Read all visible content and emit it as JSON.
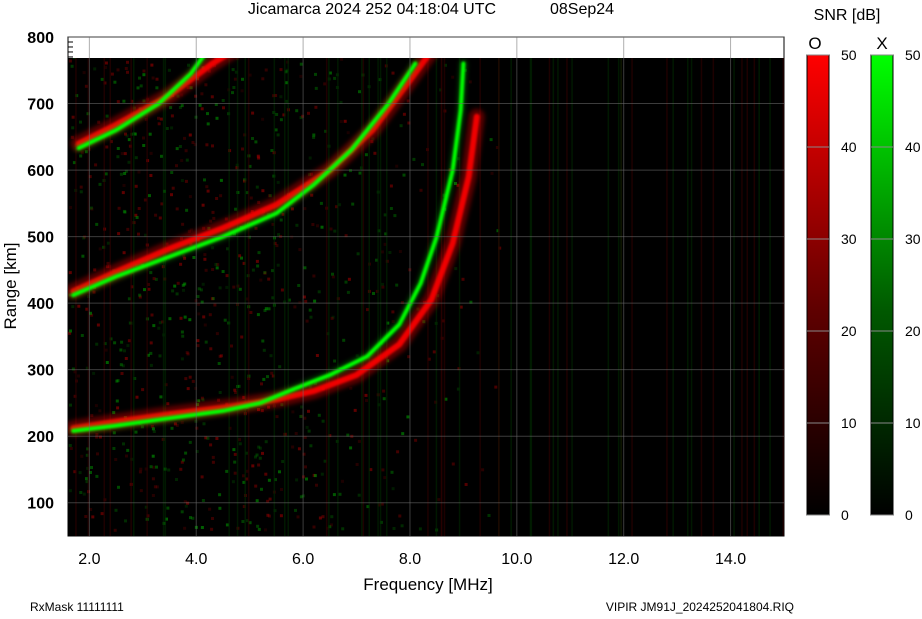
{
  "header": {
    "title": "Jicamarca 2024 252 04:18:04 UTC",
    "date": "08Sep24"
  },
  "footer": {
    "rxmask": "RxMask 11111111",
    "filename": "VIPIR  JM91J_2024252041804.RIQ"
  },
  "colorbars": {
    "title": "SNR [dB]",
    "o_label": "O",
    "x_label": "X",
    "ticks": [
      "50",
      "40",
      "30",
      "20",
      "10",
      "0"
    ],
    "o_color": "#ff0000",
    "x_color": "#00ff00",
    "range": [
      0,
      50
    ]
  },
  "chart_data": {
    "type": "heatmap",
    "title": "Jicamarca 2024 252 04:18:04 UTC",
    "xlabel": "Frequency [MHz]",
    "ylabel": "Range [km]",
    "xlim": [
      1.6,
      15.0
    ],
    "ylim": [
      50,
      800
    ],
    "x_ticks": [
      "2.0",
      "4.0",
      "6.0",
      "8.0",
      "10.0",
      "12.0",
      "14.0"
    ],
    "y_ticks": [
      "100",
      "200",
      "300",
      "400",
      "500",
      "600",
      "700",
      "800"
    ],
    "background": "#000000",
    "grid": true,
    "series": [
      {
        "name": "O",
        "color": "#ff0000",
        "traces": [
          {
            "points": [
              [
                1.7,
                212
              ],
              [
                2.5,
                222
              ],
              [
                3.5,
                233
              ],
              [
                4.5,
                243
              ],
              [
                5.5,
                255
              ],
              [
                6.2,
                268
              ],
              [
                7.0,
                292
              ],
              [
                7.8,
                338
              ],
              [
                8.4,
                405
              ],
              [
                8.8,
                490
              ],
              [
                9.1,
                590
              ],
              [
                9.25,
                680
              ]
            ]
          },
          {
            "points": [
              [
                1.7,
                418
              ],
              [
                2.5,
                447
              ],
              [
                3.5,
                482
              ],
              [
                4.5,
                513
              ],
              [
                5.5,
                548
              ],
              [
                6.5,
                600
              ],
              [
                7.3,
                660
              ],
              [
                8.0,
                735
              ],
              [
                8.5,
                790
              ]
            ]
          },
          {
            "points": [
              [
                1.8,
                640
              ],
              [
                2.5,
                668
              ],
              [
                3.5,
                712
              ],
              [
                4.3,
                760
              ],
              [
                4.9,
                790
              ]
            ]
          }
        ]
      },
      {
        "name": "X",
        "color": "#00ff00",
        "traces": [
          {
            "points": [
              [
                1.7,
                208
              ],
              [
                2.5,
                216
              ],
              [
                3.5,
                227
              ],
              [
                4.5,
                238
              ],
              [
                5.2,
                250
              ],
              [
                5.8,
                270
              ],
              [
                6.5,
                292
              ],
              [
                7.2,
                320
              ],
              [
                7.8,
                368
              ],
              [
                8.2,
                430
              ],
              [
                8.5,
                500
              ],
              [
                8.8,
                600
              ],
              [
                8.95,
                690
              ],
              [
                9.0,
                760
              ]
            ]
          },
          {
            "points": [
              [
                1.7,
                412
              ],
              [
                2.5,
                440
              ],
              [
                3.5,
                470
              ],
              [
                4.5,
                500
              ],
              [
                5.5,
                535
              ],
              [
                6.2,
                578
              ],
              [
                6.9,
                630
              ],
              [
                7.6,
                700
              ],
              [
                8.1,
                760
              ]
            ]
          },
          {
            "points": [
              [
                1.8,
                633
              ],
              [
                2.5,
                660
              ],
              [
                3.3,
                700
              ],
              [
                3.9,
                745
              ],
              [
                4.3,
                790
              ]
            ]
          }
        ]
      }
    ]
  }
}
